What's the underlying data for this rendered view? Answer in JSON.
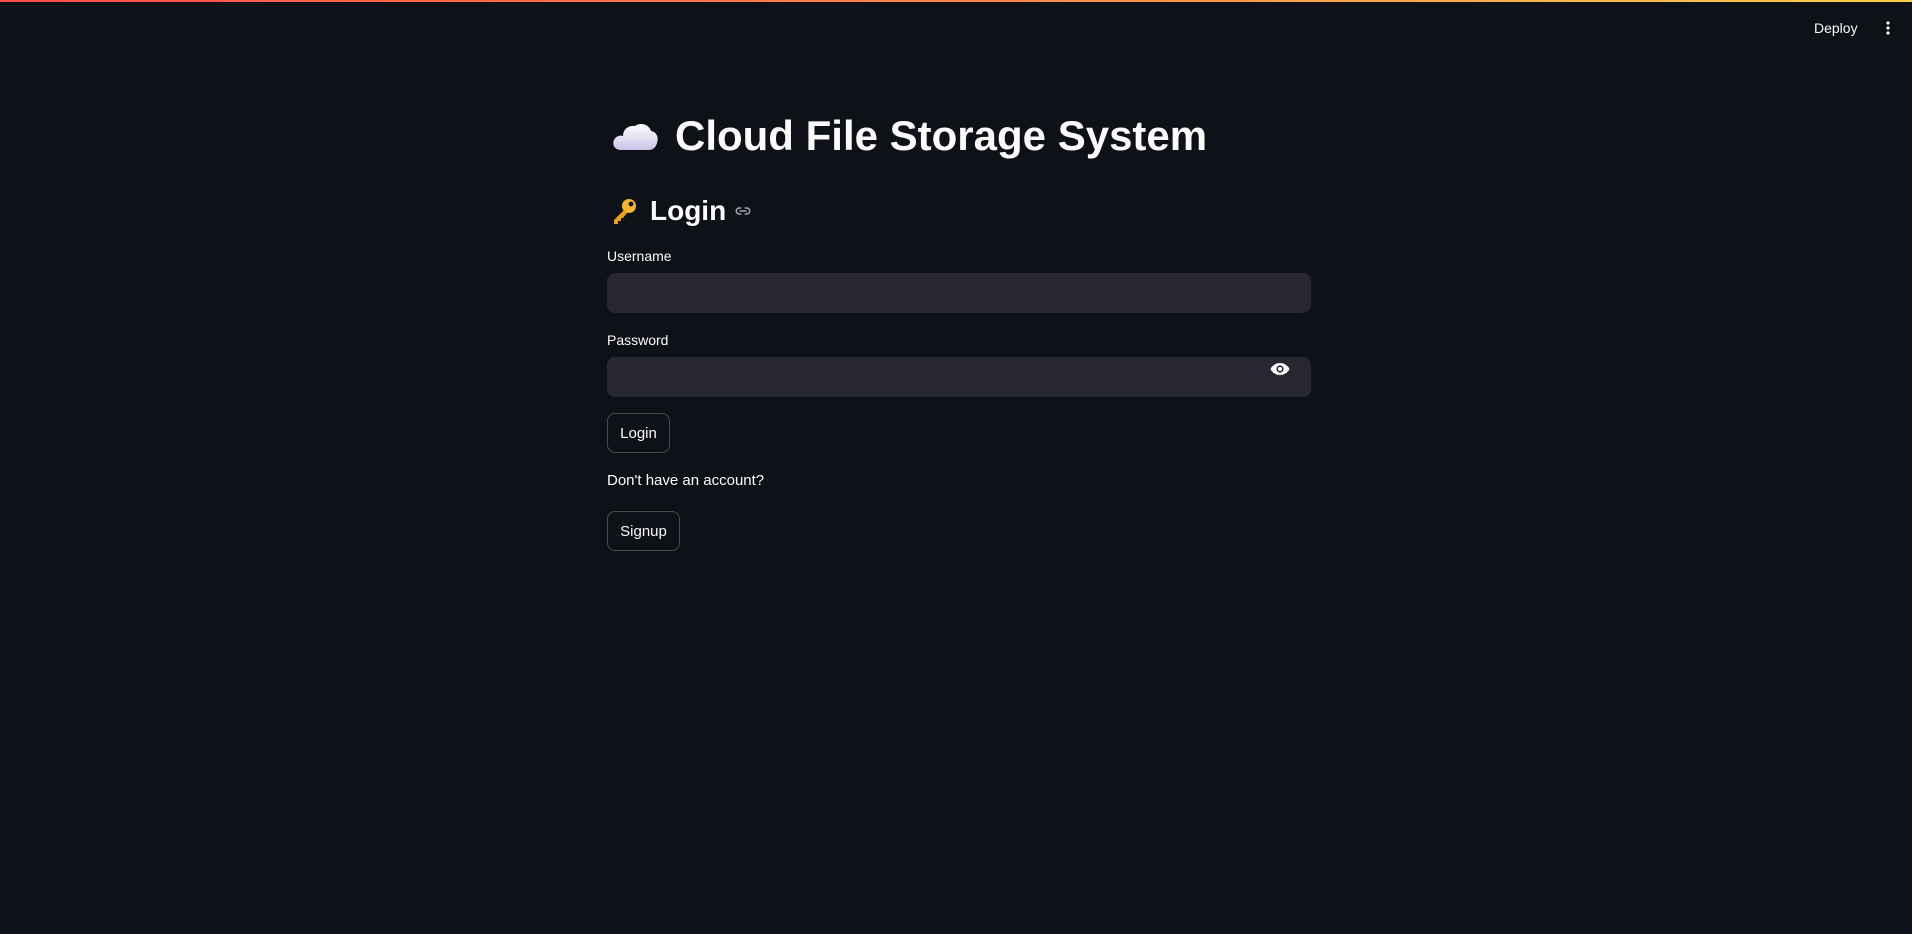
{
  "header": {
    "deploy_label": "Deploy",
    "menu_icon": "more-vertical-icon"
  },
  "page": {
    "title": "Cloud File Storage System",
    "title_icon": "cloud-icon"
  },
  "login_section": {
    "heading": "Login",
    "heading_icon": "key-icon",
    "anchor_icon": "link-icon"
  },
  "form": {
    "username_label": "Username",
    "username_value": "",
    "password_label": "Password",
    "password_value": "",
    "password_toggle_icon": "eye-icon",
    "login_button": "Login"
  },
  "signup": {
    "prompt": "Don't have an account?",
    "button": "Signup"
  }
}
